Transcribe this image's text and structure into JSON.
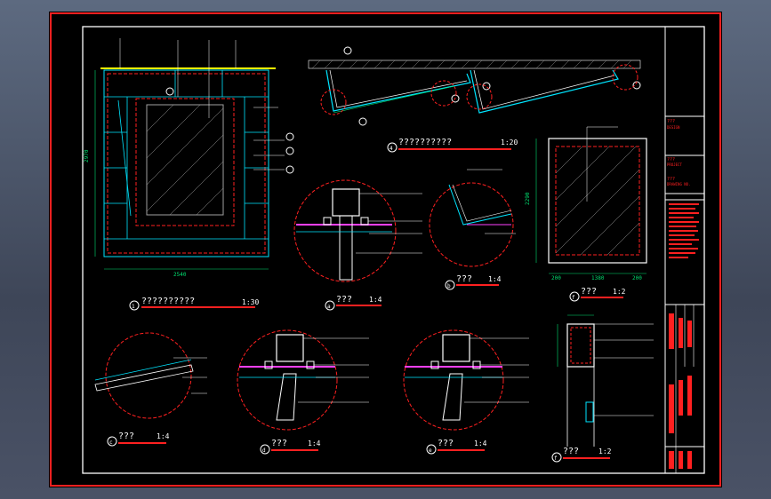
{
  "drawing": {
    "colors": {
      "frame": "#ff2020",
      "inner_frame": "#ffffff",
      "wall": "#00e5ff",
      "dim": "#00e070",
      "hatch": "#a0a0a0",
      "title_bar": "#ff2020",
      "yellow": "#ffff00",
      "magenta": "#ff40ff",
      "background": "#000000"
    },
    "views": {
      "elevation_main": {
        "title": "??????????",
        "scale": "1:30",
        "callout": "1",
        "dim_width": "2540",
        "dim_height": "2970"
      },
      "section_top": {
        "title": "??????????",
        "scale": "1:20",
        "callout": "4"
      },
      "detail_a": {
        "title": "???",
        "scale": "1:4",
        "callout": "a"
      },
      "detail_b": {
        "title": "???",
        "scale": "1:4",
        "callout": "b"
      },
      "detail_c": {
        "title": "???",
        "scale": "1:4",
        "callout": "c"
      },
      "detail_d": {
        "title": "???",
        "scale": "1:4",
        "callout": "d"
      },
      "detail_e": {
        "title": "???",
        "scale": "1:4",
        "callout": "e"
      },
      "detail_f": {
        "title": "???",
        "scale": "1:2",
        "callout": "f"
      },
      "panel_elev": {
        "title": "???",
        "scale": "1:2",
        "callout": "f",
        "dims": [
          "200",
          "1380",
          "200"
        ],
        "height": "2290"
      }
    },
    "title_block": {
      "rows": [
        "??",
        "???",
        "???",
        "?????",
        "???????"
      ]
    }
  }
}
